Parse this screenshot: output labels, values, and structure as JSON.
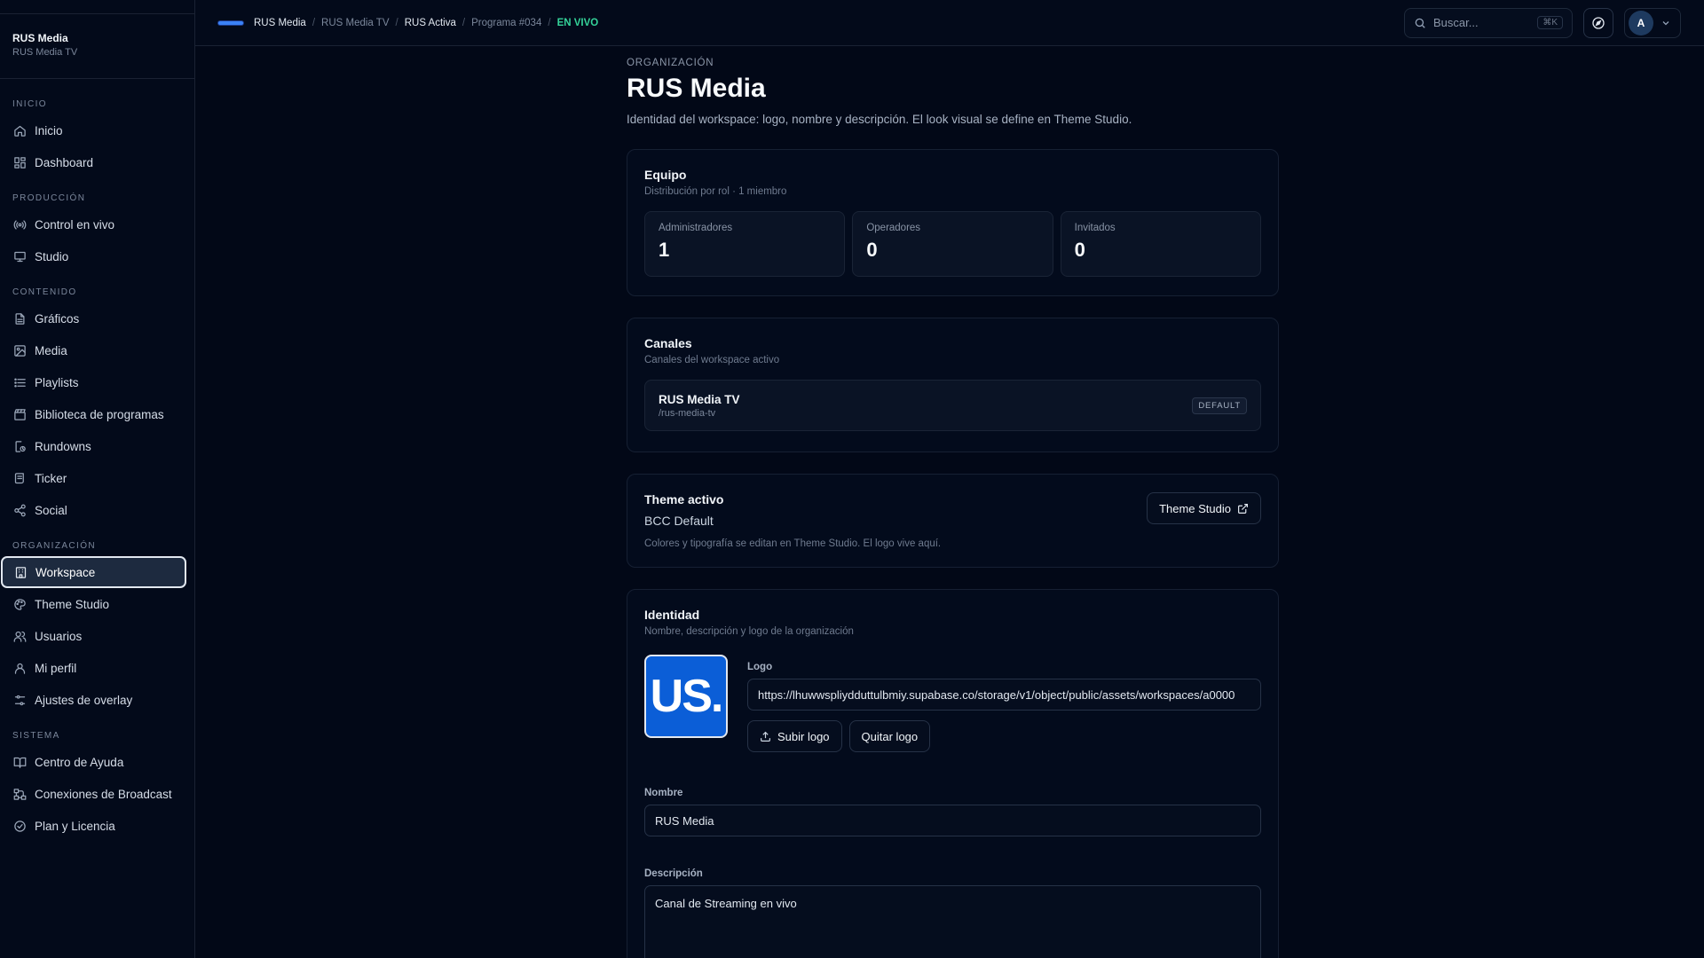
{
  "sidebar": {
    "org_name": "RUS Media",
    "org_sub": "RUS Media TV",
    "sections": [
      {
        "label": "INICIO",
        "items": [
          {
            "label": "Inicio",
            "icon": "home-icon"
          },
          {
            "label": "Dashboard",
            "icon": "grid-icon"
          }
        ]
      },
      {
        "label": "PRODUCCIÓN",
        "items": [
          {
            "label": "Control en vivo",
            "icon": "broadcast-icon"
          },
          {
            "label": "Studio",
            "icon": "monitor-icon"
          }
        ]
      },
      {
        "label": "CONTENIDO",
        "items": [
          {
            "label": "Gráficos",
            "icon": "file-icon"
          },
          {
            "label": "Media",
            "icon": "image-icon"
          },
          {
            "label": "Playlists",
            "icon": "list-icon"
          },
          {
            "label": "Biblioteca de programas",
            "icon": "clapper-icon"
          },
          {
            "label": "Rundowns",
            "icon": "clock-doc-icon"
          },
          {
            "label": "Ticker",
            "icon": "scroll-icon"
          },
          {
            "label": "Social",
            "icon": "share-icon"
          }
        ]
      },
      {
        "label": "ORGANIZACIÓN",
        "items": [
          {
            "label": "Workspace",
            "icon": "building-icon",
            "active": true
          },
          {
            "label": "Theme Studio",
            "icon": "palette-icon"
          },
          {
            "label": "Usuarios",
            "icon": "users-icon"
          },
          {
            "label": "Mi perfil",
            "icon": "user-icon"
          },
          {
            "label": "Ajustes de overlay",
            "icon": "sliders-icon"
          }
        ]
      },
      {
        "label": "SISTEMA",
        "items": [
          {
            "label": "Centro de Ayuda",
            "icon": "book-icon"
          },
          {
            "label": "Conexiones de Broadcast",
            "icon": "network-icon"
          },
          {
            "label": "Plan y Licencia",
            "icon": "check-circle-icon"
          }
        ]
      }
    ]
  },
  "topbar": {
    "crumbs": [
      "RUS Media",
      "RUS Media TV",
      "RUS Activa",
      "Programa #034",
      "EN VIVO"
    ],
    "search_placeholder": "Buscar...",
    "search_kbd": "⌘K",
    "avatar_initial": "A"
  },
  "main": {
    "eyebrow": "ORGANIZACIÓN",
    "title": "RUS Media",
    "description": "Identidad del workspace: logo, nombre y descripción. El look visual se define en Theme Studio.",
    "team": {
      "title": "Equipo",
      "subtitle": "Distribución por rol · 1 miembro",
      "stats": [
        {
          "label": "Administradores",
          "value": "1"
        },
        {
          "label": "Operadores",
          "value": "0"
        },
        {
          "label": "Invitados",
          "value": "0"
        }
      ]
    },
    "channels": {
      "title": "Canales",
      "subtitle": "Canales del workspace activo",
      "items": [
        {
          "name": "RUS Media TV",
          "slug": "/rus-media-tv",
          "badge": "DEFAULT"
        }
      ]
    },
    "theme": {
      "title": "Theme activo",
      "name": "BCC Default",
      "note": "Colores y tipografía se editan en Theme Studio. El logo vive aquí.",
      "button": "Theme Studio"
    },
    "identity": {
      "title": "Identidad",
      "subtitle": "Nombre, descripción y logo de la organización",
      "logo_text": "US.",
      "logo_label": "Logo",
      "logo_url": "https://lhuwwspliydduttulbmiy.supabase.co/storage/v1/object/public/assets/workspaces/a0000",
      "upload_button": "Subir logo",
      "remove_button": "Quitar logo",
      "name_label": "Nombre",
      "name_value": "RUS Media",
      "desc_label": "Descripción",
      "desc_value": "Canal de Streaming en vivo"
    }
  },
  "colors": {
    "background": "#020817",
    "accent_live": "#34d399",
    "logo_blue": "#0b5ed7"
  }
}
